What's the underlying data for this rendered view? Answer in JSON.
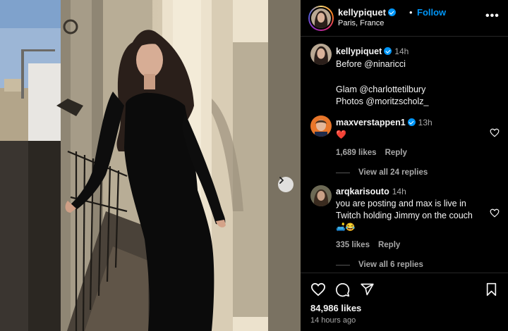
{
  "post": {
    "author": "kellypiquet",
    "location": "Paris, France",
    "follow_label": "Follow",
    "dot": "•",
    "more_label": "•••"
  },
  "caption": {
    "user": "kellypiquet",
    "time": "14h",
    "lines": [
      "Before @ninaricci",
      "Glam @charlottetilbury",
      "Photos @moritzscholz_"
    ]
  },
  "comments": [
    {
      "user": "maxverstappen1",
      "time": "13h",
      "verified": true,
      "text": "❤️",
      "likes": "1,689 likes",
      "reply_label": "Reply",
      "view_replies": "View all 24 replies"
    },
    {
      "user": "arqkarisouto",
      "time": "14h",
      "verified": false,
      "text": "you are posting and max is live in Twitch holding Jimmy on the couch",
      "emoji": "🛋️😂",
      "likes": "335 likes",
      "reply_label": "Reply",
      "view_replies": "View all 6 replies"
    }
  ],
  "footer": {
    "likes": "84,986 likes",
    "ago": "14 hours ago"
  },
  "icons": {
    "like": "heart-icon",
    "comment": "comment-icon",
    "share": "share-icon",
    "save": "bookmark-icon",
    "next": "chevron-right-icon",
    "verified": "verified-badge-icon"
  },
  "colors": {
    "link": "#0095f6",
    "muted": "#a8a8a8",
    "text": "#f5f5f5",
    "divider": "#262626",
    "heart_red": "#ff3040"
  }
}
